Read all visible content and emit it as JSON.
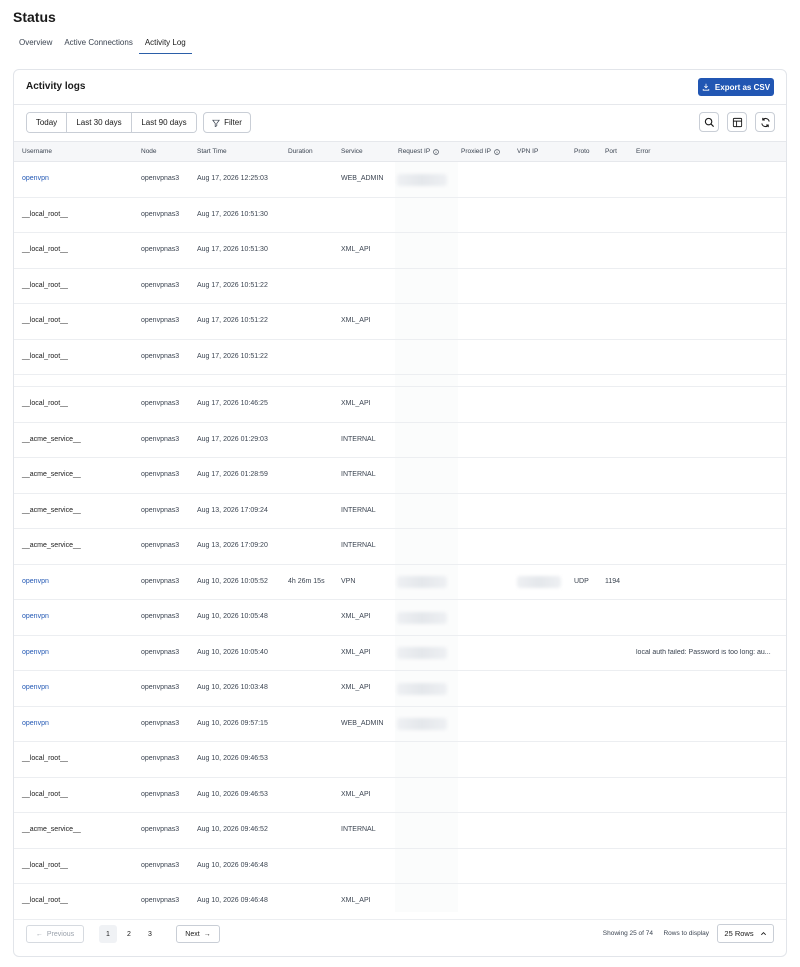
{
  "page": {
    "title": "Status"
  },
  "tabs": [
    {
      "label": "Overview",
      "active": false
    },
    {
      "label": "Active Connections",
      "active": false
    },
    {
      "label": "Activity Log",
      "active": true
    }
  ],
  "card": {
    "title": "Activity logs",
    "export_label": "Export as CSV",
    "export_icon": "download-icon"
  },
  "toolbar": {
    "ranges": [
      "Today",
      "Last 30 days",
      "Last 90 days"
    ],
    "filter_label": "Filter",
    "filter_icon": "filter-icon",
    "icons": [
      "search-icon",
      "columns-icon",
      "refresh-icon"
    ]
  },
  "columns": [
    "Username",
    "Node",
    "Start Time",
    "Duration",
    "Service",
    "Request IP",
    "Proxied IP",
    "VPN IP",
    "Proto",
    "Port",
    "Error"
  ],
  "rows": [
    {
      "user": "openvpn",
      "node": "openvpnas3",
      "start": "Aug 17, 2026 12:25:03",
      "duration": "",
      "service": "WEB_ADMIN",
      "proto": "",
      "port": "",
      "error": "",
      "req_ip": true,
      "vpn_ip": false
    },
    {
      "user": "__local_root__",
      "node": "openvpnas3",
      "start": "Aug 17, 2026 10:51:30",
      "duration": "",
      "service": "",
      "proto": "",
      "port": "",
      "error": "",
      "req_ip": false,
      "vpn_ip": false
    },
    {
      "user": "__local_root__",
      "node": "openvpnas3",
      "start": "Aug 17, 2026 10:51:30",
      "duration": "",
      "service": "XML_API",
      "proto": "",
      "port": "",
      "error": "",
      "req_ip": false,
      "vpn_ip": false
    },
    {
      "user": "__local_root__",
      "node": "openvpnas3",
      "start": "Aug 17, 2026 10:51:22",
      "duration": "",
      "service": "",
      "proto": "",
      "port": "",
      "error": "",
      "req_ip": false,
      "vpn_ip": false
    },
    {
      "user": "__local_root__",
      "node": "openvpnas3",
      "start": "Aug 17, 2026 10:51:22",
      "duration": "",
      "service": "XML_API",
      "proto": "",
      "port": "",
      "error": "",
      "req_ip": false,
      "vpn_ip": false
    },
    {
      "user": "__local_root__",
      "node": "openvpnas3",
      "start": "Aug 17, 2026 10:51:22",
      "duration": "",
      "service": "",
      "proto": "",
      "port": "",
      "error": "",
      "req_ip": false,
      "vpn_ip": false
    },
    {
      "user": "",
      "node": "",
      "start": "",
      "duration": "",
      "service": "",
      "proto": "",
      "port": "",
      "error": "",
      "req_ip": false,
      "vpn_ip": false
    },
    {
      "user": "__local_root__",
      "node": "openvpnas3",
      "start": "Aug 17, 2026 10:46:25",
      "duration": "",
      "service": "XML_API",
      "proto": "",
      "port": "",
      "error": "",
      "req_ip": false,
      "vpn_ip": false
    },
    {
      "user": "__acme_service__",
      "node": "openvpnas3",
      "start": "Aug 17, 2026 01:29:03",
      "duration": "",
      "service": "INTERNAL",
      "proto": "",
      "port": "",
      "error": "",
      "req_ip": false,
      "vpn_ip": false
    },
    {
      "user": "__acme_service__",
      "node": "openvpnas3",
      "start": "Aug 17, 2026 01:28:59",
      "duration": "",
      "service": "INTERNAL",
      "proto": "",
      "port": "",
      "error": "",
      "req_ip": false,
      "vpn_ip": false
    },
    {
      "user": "__acme_service__",
      "node": "openvpnas3",
      "start": "Aug 13, 2026 17:09:24",
      "duration": "",
      "service": "INTERNAL",
      "proto": "",
      "port": "",
      "error": "",
      "req_ip": false,
      "vpn_ip": false
    },
    {
      "user": "__acme_service__",
      "node": "openvpnas3",
      "start": "Aug 13, 2026 17:09:20",
      "duration": "",
      "service": "INTERNAL",
      "proto": "",
      "port": "",
      "error": "",
      "req_ip": false,
      "vpn_ip": false
    },
    {
      "user": "openvpn",
      "node": "openvpnas3",
      "start": "Aug 10, 2026 10:05:52",
      "duration": "4h 26m 15s",
      "service": "VPN",
      "proto": "UDP",
      "port": "1194",
      "error": "",
      "req_ip": true,
      "vpn_ip": true
    },
    {
      "user": "openvpn",
      "node": "openvpnas3",
      "start": "Aug 10, 2026 10:05:48",
      "duration": "",
      "service": "XML_API",
      "proto": "",
      "port": "",
      "error": "",
      "req_ip": true,
      "vpn_ip": false
    },
    {
      "user": "openvpn",
      "node": "openvpnas3",
      "start": "Aug 10, 2026 10:05:40",
      "duration": "",
      "service": "XML_API",
      "proto": "",
      "port": "",
      "error": "local auth failed: Password is too long: au...",
      "req_ip": true,
      "vpn_ip": false
    },
    {
      "user": "openvpn",
      "node": "openvpnas3",
      "start": "Aug 10, 2026 10:03:48",
      "duration": "",
      "service": "XML_API",
      "proto": "",
      "port": "",
      "error": "",
      "req_ip": true,
      "vpn_ip": false
    },
    {
      "user": "openvpn",
      "node": "openvpnas3",
      "start": "Aug 10, 2026 09:57:15",
      "duration": "",
      "service": "WEB_ADMIN",
      "proto": "",
      "port": "",
      "error": "",
      "req_ip": true,
      "vpn_ip": false
    },
    {
      "user": "__local_root__",
      "node": "openvpnas3",
      "start": "Aug 10, 2026 09:46:53",
      "duration": "",
      "service": "",
      "proto": "",
      "port": "",
      "error": "",
      "req_ip": false,
      "vpn_ip": false
    },
    {
      "user": "__local_root__",
      "node": "openvpnas3",
      "start": "Aug 10, 2026 09:46:53",
      "duration": "",
      "service": "XML_API",
      "proto": "",
      "port": "",
      "error": "",
      "req_ip": false,
      "vpn_ip": false
    },
    {
      "user": "__acme_service__",
      "node": "openvpnas3",
      "start": "Aug 10, 2026 09:46:52",
      "duration": "",
      "service": "INTERNAL",
      "proto": "",
      "port": "",
      "error": "",
      "req_ip": false,
      "vpn_ip": false
    },
    {
      "user": "__local_root__",
      "node": "openvpnas3",
      "start": "Aug 10, 2026 09:46:48",
      "duration": "",
      "service": "",
      "proto": "",
      "port": "",
      "error": "",
      "req_ip": false,
      "vpn_ip": false
    },
    {
      "user": "__local_root__",
      "node": "openvpnas3",
      "start": "Aug 10, 2026 09:46:48",
      "duration": "",
      "service": "XML_API",
      "proto": "",
      "port": "",
      "error": "",
      "req_ip": false,
      "vpn_ip": false
    }
  ],
  "pagination": {
    "prev_label": "Previous",
    "next_label": "Next",
    "pages": [
      "1",
      "2",
      "3"
    ],
    "current_page": "1",
    "showing_text": "Showing 25 of 74",
    "rows_label": "Rows to display",
    "rows_value": "25 Rows"
  },
  "colors": {
    "accent": "#2156b3",
    "link": "#2459b5",
    "header_bg": "#f6f7f9",
    "border": "#e2e5ea"
  }
}
